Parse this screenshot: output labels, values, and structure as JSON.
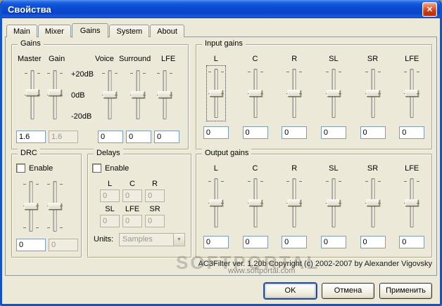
{
  "window": {
    "title": "Свойства"
  },
  "icons": {
    "close": "✕",
    "dropdown": "▼"
  },
  "colors": {
    "titlebar_blue": "#0b4ad2",
    "dialog_bg": "#ece9d8",
    "close_red": "#d03c16",
    "edit_border": "#7f9db9"
  },
  "tabs": [
    {
      "label": "Main"
    },
    {
      "label": "Mixer"
    },
    {
      "label": "Gains"
    },
    {
      "label": "System"
    },
    {
      "label": "About"
    }
  ],
  "gains": {
    "title": "Gains",
    "columns": [
      "Master",
      "Gain",
      "Voice",
      "Surround",
      "LFE"
    ],
    "scale": [
      "+20dB",
      "0dB",
      "-20dB"
    ],
    "master_value": "1.6",
    "gain_value": "1.6",
    "voice_value": "0",
    "surround_value": "0",
    "lfe_value": "0"
  },
  "input_gains": {
    "title": "Input gains",
    "channels": [
      {
        "label": "L",
        "value": "0"
      },
      {
        "label": "C",
        "value": "0"
      },
      {
        "label": "R",
        "value": "0"
      },
      {
        "label": "SL",
        "value": "0"
      },
      {
        "label": "SR",
        "value": "0"
      },
      {
        "label": "LFE",
        "value": "0"
      }
    ]
  },
  "output_gains": {
    "title": "Output gains",
    "channels": [
      {
        "label": "L",
        "value": "0"
      },
      {
        "label": "C",
        "value": "0"
      },
      {
        "label": "R",
        "value": "0"
      },
      {
        "label": "SL",
        "value": "0"
      },
      {
        "label": "SR",
        "value": "0"
      },
      {
        "label": "LFE",
        "value": "0"
      }
    ]
  },
  "drc": {
    "title": "DRC",
    "enable_label": "Enable",
    "value": "0",
    "value2": "0"
  },
  "delays": {
    "title": "Delays",
    "enable_label": "Enable",
    "fields": [
      {
        "label": "L",
        "value": "0"
      },
      {
        "label": "C",
        "value": "0"
      },
      {
        "label": "R",
        "value": "0"
      },
      {
        "label": "SL",
        "value": "0"
      },
      {
        "label": "LFE",
        "value": "0"
      },
      {
        "label": "SR",
        "value": "0"
      }
    ],
    "units_label": "Units:",
    "units_value": "Samples"
  },
  "footer": {
    "copyright": "AC3Filter ver. 1.20b Copyright (c) 2002-2007 by Alexander Vigovsky",
    "watermark_site": "www.softportal.com",
    "watermark_logo": "SOFTPORTAL"
  },
  "buttons": {
    "ok": "OK",
    "cancel": "Отмена",
    "apply": "Применить"
  }
}
